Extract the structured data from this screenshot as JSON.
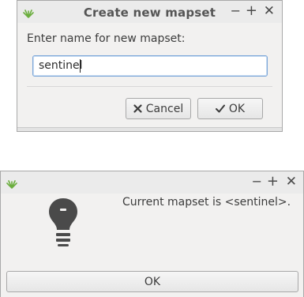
{
  "create_dialog": {
    "title": "Create new mapset",
    "window_controls": {
      "minimize": "−",
      "maximize": "+",
      "close": "✕"
    },
    "prompt": "Enter name for new mapset:",
    "input_value": "sentinel",
    "buttons": {
      "cancel": "Cancel",
      "ok": "OK"
    },
    "icons": {
      "app": "grass-icon",
      "cancel": "close-icon",
      "ok": "checkmark-icon"
    }
  },
  "info_dialog": {
    "title": "",
    "window_controls": {
      "minimize": "−",
      "maximize": "+",
      "close": "✕"
    },
    "message": "Current mapset is <sentinel>.",
    "ok_label": "OK",
    "icons": {
      "app": "grass-icon",
      "info": "lightbulb-icon"
    }
  },
  "colors": {
    "accent_green": "#6bae3e",
    "input_focus": "#7da7d9"
  }
}
